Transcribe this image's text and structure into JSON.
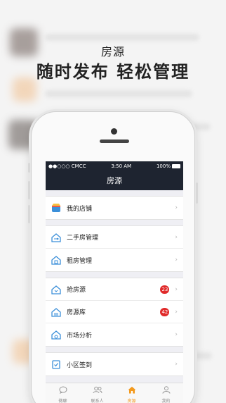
{
  "headline": {
    "subtitle": "房源",
    "title": "随时发布 轻松管理"
  },
  "statusbar": {
    "carrier": "●●○○○ CMCC",
    "time": "3:50 AM",
    "battery": "100%"
  },
  "navbar": {
    "title": "房源"
  },
  "groups": [
    {
      "items": [
        {
          "label": "我的店铺",
          "icon": "store-icon"
        }
      ]
    },
    {
      "items": [
        {
          "label": "二手房管理",
          "icon": "swap-house-icon"
        },
        {
          "label": "租房管理",
          "icon": "rent-house-icon"
        }
      ]
    },
    {
      "items": [
        {
          "label": "抢房源",
          "icon": "grab-house-icon",
          "badge": "23"
        },
        {
          "label": "房源库",
          "icon": "house-library-icon",
          "badge": "42"
        },
        {
          "label": "市场分析",
          "icon": "market-analysis-icon"
        }
      ]
    },
    {
      "items": [
        {
          "label": "小区签到",
          "icon": "checkin-icon"
        }
      ]
    }
  ],
  "chevron": "›",
  "tabbar": [
    {
      "label": "微聊",
      "icon": "chat-icon"
    },
    {
      "label": "联系人",
      "icon": "contacts-icon"
    },
    {
      "label": "房源",
      "icon": "house-icon",
      "active": true
    },
    {
      "label": "我的",
      "icon": "profile-icon"
    }
  ],
  "colors": {
    "accent": "#f39a1e",
    "nav": "#1e2430",
    "icon_blue": "#3b8fd9",
    "badge": "#e02a2a"
  }
}
